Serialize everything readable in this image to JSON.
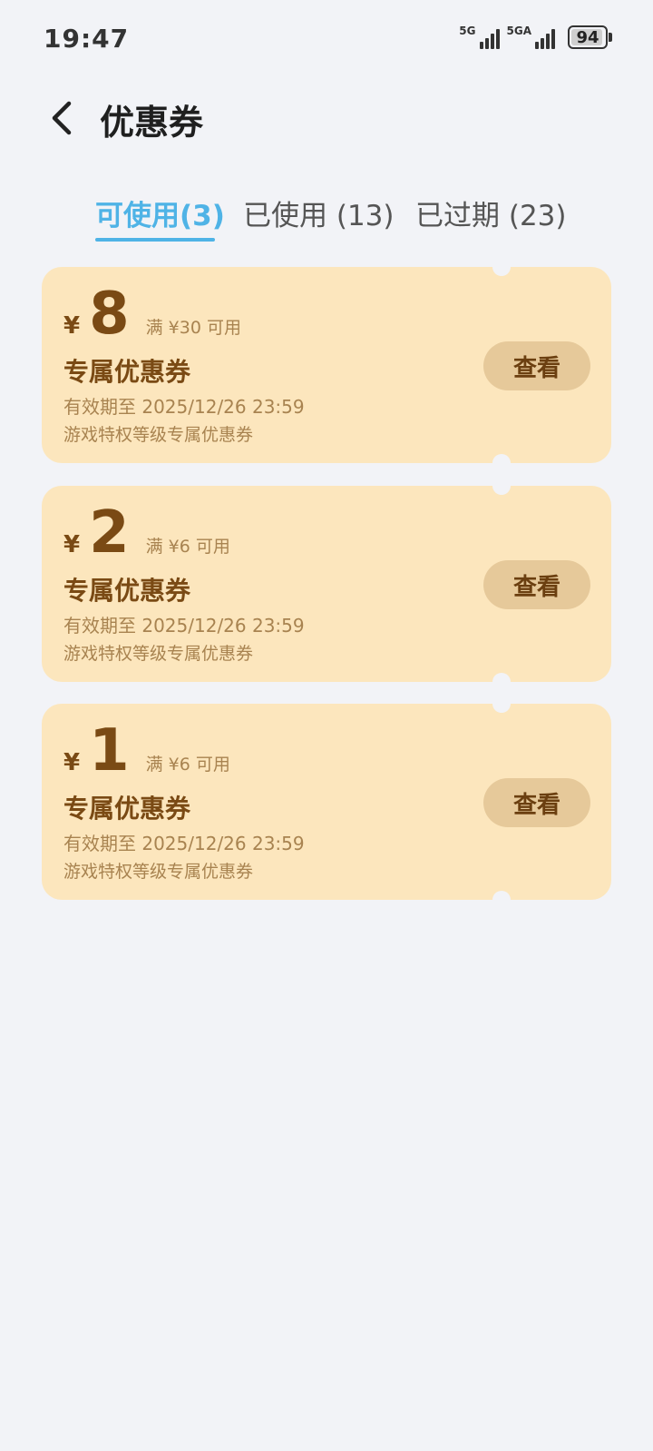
{
  "status_bar": {
    "time": "19:47",
    "network1": "5G",
    "network2": "5GA",
    "battery_level": "94"
  },
  "header": {
    "title": "优惠券"
  },
  "tabs": [
    {
      "label": "可使用(3)",
      "active": true
    },
    {
      "label": "已使用 (13)",
      "active": false
    },
    {
      "label": "已过期 (23)",
      "active": false
    }
  ],
  "coupons": [
    {
      "currency": "¥",
      "amount": "8",
      "threshold": "满 ¥30 可用",
      "name": "专属优惠券",
      "expiry": "有效期至 2025/12/26 23:59",
      "description": "游戏特权等级专属优惠券",
      "button_label": "查看"
    },
    {
      "currency": "¥",
      "amount": "2",
      "threshold": "满 ¥6 可用",
      "name": "专属优惠券",
      "expiry": "有效期至 2025/12/26 23:59",
      "description": "游戏特权等级专属优惠券",
      "button_label": "查看"
    },
    {
      "currency": "¥",
      "amount": "1",
      "threshold": "满 ¥6 可用",
      "name": "专属优惠券",
      "expiry": "有效期至 2025/12/26 23:59",
      "description": "游戏特权等级专属优惠券",
      "button_label": "查看"
    }
  ],
  "colors": {
    "accent": "#4fb3e6",
    "coupon_bg": "#fce6bd",
    "coupon_text": "#7a4a14",
    "coupon_button_bg": "#e6c99a",
    "page_bg": "#f2f3f7"
  }
}
